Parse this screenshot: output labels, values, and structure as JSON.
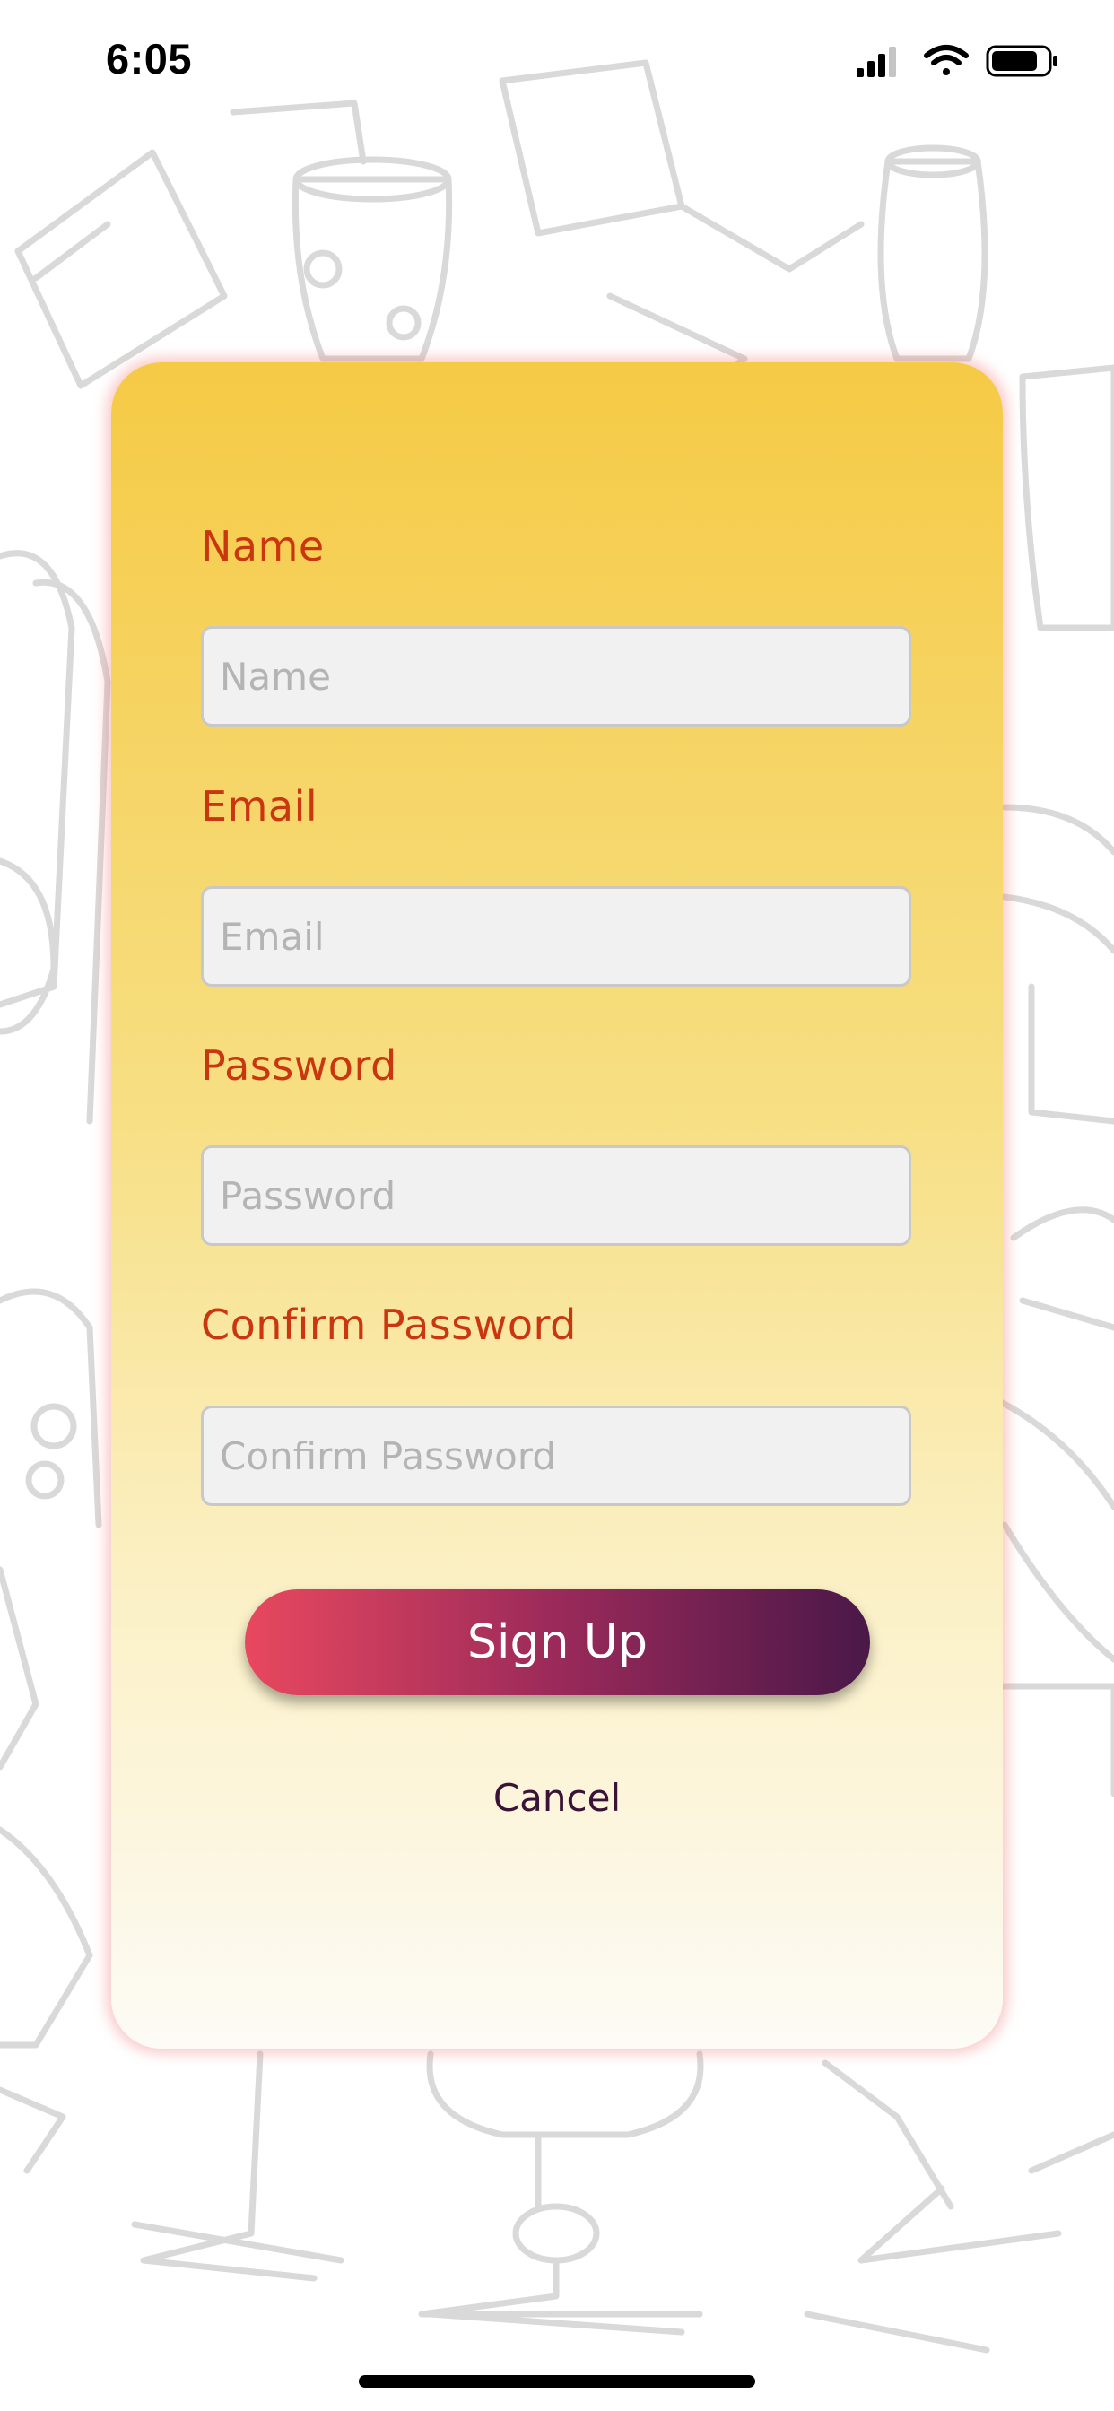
{
  "status_bar": {
    "time": "6:05",
    "icons": [
      "signal-icon",
      "wifi-icon",
      "battery-icon"
    ]
  },
  "form": {
    "fields": [
      {
        "label": "Name",
        "placeholder": "Name",
        "value": ""
      },
      {
        "label": "Email",
        "placeholder": "Email",
        "value": ""
      },
      {
        "label": "Password",
        "placeholder": "Password",
        "value": ""
      },
      {
        "label": "Confirm Password",
        "placeholder": "Confirm Password",
        "value": ""
      }
    ],
    "signup_label": "Sign Up",
    "cancel_label": "Cancel"
  },
  "colors": {
    "label": "#c9360f",
    "card_top": "#f5ca45",
    "card_bottom": "#fdfbf6",
    "button_start": "#e8485f",
    "button_end": "#4a1848",
    "input_bg": "#f1f1f1",
    "cancel": "#3a1336"
  },
  "background_pattern": "glasses-sketch"
}
